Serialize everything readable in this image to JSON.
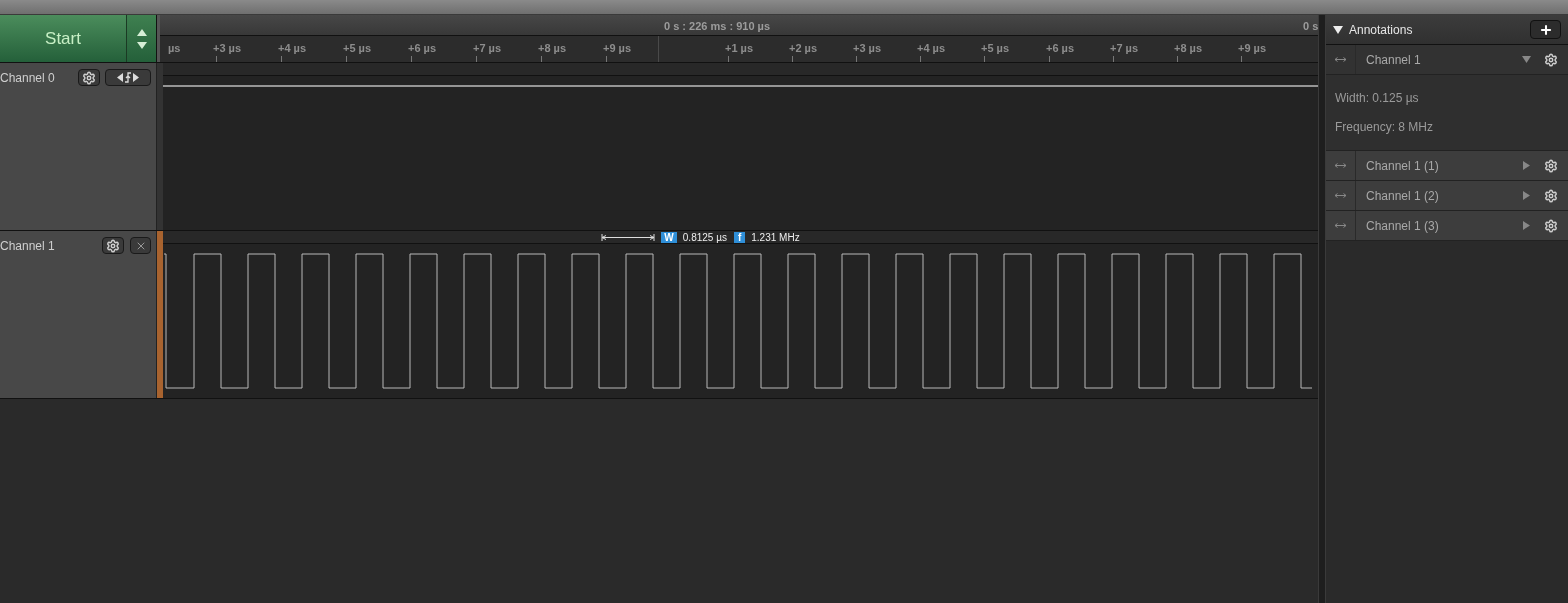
{
  "start_button": {
    "label": "Start"
  },
  "ruler": {
    "time_label": "0 s : 226 ms : 910 µs",
    "next_time_label": "0 s",
    "ticks": [
      "µs",
      "+3 µs",
      "+4 µs",
      "+5 µs",
      "+6 µs",
      "+7 µs",
      "+8 µs",
      "+9 µs",
      "+1 µs",
      "+2 µs",
      "+3 µs",
      "+4 µs",
      "+5 µs",
      "+6 µs",
      "+7 µs",
      "+8 µs",
      "+9 µs"
    ]
  },
  "channels": [
    {
      "name": "Channel 0",
      "kind": "trigger"
    },
    {
      "name": "Channel 1",
      "kind": "clock"
    }
  ],
  "measurement": {
    "width_badge": "W",
    "width": "0.8125 µs",
    "frequency_badge": "f",
    "frequency": "1.231 MHz"
  },
  "annotations": {
    "title": "Annotations",
    "items": [
      {
        "label": "Channel 1",
        "expanded": true,
        "details": [
          "Width: 0.125 µs",
          "Frequency: 8 MHz"
        ]
      },
      {
        "label": "Channel 1 (1)",
        "expanded": false
      },
      {
        "label": "Channel 1 (2)",
        "expanded": false
      },
      {
        "label": "Channel 1 (3)",
        "expanded": false
      }
    ]
  }
}
